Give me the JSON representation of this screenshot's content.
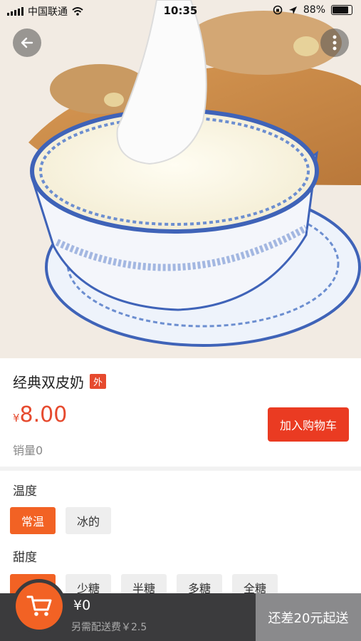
{
  "status_bar": {
    "carrier": "中国联通",
    "time": "10:35",
    "battery": "88%"
  },
  "product": {
    "name": "经典双皮奶",
    "tag": "外",
    "currency": "¥",
    "price": "8.00",
    "sales": "销量0",
    "add_to_cart": "加入购物车"
  },
  "options": [
    {
      "label": "温度",
      "choices": [
        "常温",
        "冰的"
      ],
      "selected": 0
    },
    {
      "label": "甜度",
      "choices": [
        "",
        "少糖",
        "半糖",
        "多糖",
        "全糖"
      ],
      "selected": 0
    }
  ],
  "footer": {
    "total": "¥0",
    "delivery_fee": "另需配送费￥2.5",
    "min_order": "还差20元起送"
  },
  "colors": {
    "accent": "#f26224",
    "price": "#e64a2e",
    "cart_button": "#ea3b22"
  }
}
